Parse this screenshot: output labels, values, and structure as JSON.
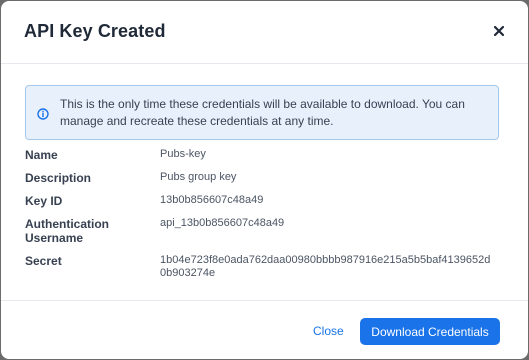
{
  "dialog": {
    "title": "API Key Created",
    "close_icon": "close-icon"
  },
  "notice": {
    "icon": "info-icon",
    "text": "This is the only time these credentials will be available to download. You can manage and recreate these credentials at any time."
  },
  "details": [
    {
      "label": "Name",
      "value": "Pubs-key"
    },
    {
      "label": "Description",
      "value": "Pubs group key"
    },
    {
      "label": "Key ID",
      "value": "13b0b856607c48a49"
    },
    {
      "label": "Authentication Username",
      "value": "api_13b0b856607c48a49"
    },
    {
      "label": "Secret",
      "value": "1b04e723f8e0ada762daa00980bbbb987916e215a5b5baf4139652d0b903274e"
    }
  ],
  "footer": {
    "close_label": "Close",
    "download_label": "Download Credentials"
  },
  "colors": {
    "primary": "#1a73e8",
    "info_bg": "#e8f1fb",
    "info_border": "#a8c7ea"
  }
}
